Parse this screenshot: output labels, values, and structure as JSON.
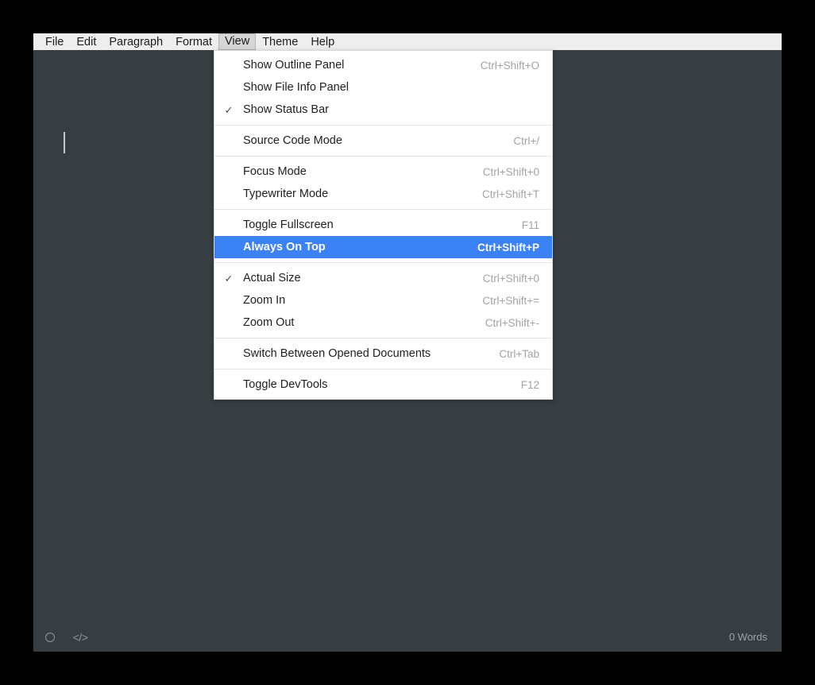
{
  "window": {
    "background_color": "#373e42",
    "menubar_color": "#eeeeee",
    "accent_color": "#3b82f6"
  },
  "menubar": {
    "items": [
      {
        "label": "File",
        "active": false
      },
      {
        "label": "Edit",
        "active": false
      },
      {
        "label": "Paragraph",
        "active": false
      },
      {
        "label": "Format",
        "active": false
      },
      {
        "label": "View",
        "active": true
      },
      {
        "label": "Theme",
        "active": false
      },
      {
        "label": "Help",
        "active": false
      }
    ]
  },
  "view_menu": {
    "groups": [
      {
        "items": [
          {
            "label": "Show Outline Panel",
            "shortcut": "Ctrl+Shift+O",
            "checked": false,
            "highlighted": false
          },
          {
            "label": "Show File Info Panel",
            "shortcut": "",
            "checked": false,
            "highlighted": false
          },
          {
            "label": "Show Status Bar",
            "shortcut": "",
            "checked": true,
            "highlighted": false
          }
        ]
      },
      {
        "items": [
          {
            "label": "Source Code Mode",
            "shortcut": "Ctrl+/",
            "checked": false,
            "highlighted": false
          }
        ]
      },
      {
        "items": [
          {
            "label": "Focus Mode",
            "shortcut": "Ctrl+Shift+0",
            "checked": false,
            "highlighted": false
          },
          {
            "label": "Typewriter Mode",
            "shortcut": "Ctrl+Shift+T",
            "checked": false,
            "highlighted": false
          }
        ]
      },
      {
        "items": [
          {
            "label": "Toggle Fullscreen",
            "shortcut": "F11",
            "checked": false,
            "highlighted": false
          },
          {
            "label": "Always On Top",
            "shortcut": "Ctrl+Shift+P",
            "checked": false,
            "highlighted": true
          }
        ]
      },
      {
        "items": [
          {
            "label": "Actual Size",
            "shortcut": "Ctrl+Shift+0",
            "checked": true,
            "highlighted": false
          },
          {
            "label": "Zoom In",
            "shortcut": "Ctrl+Shift+=",
            "checked": false,
            "highlighted": false
          },
          {
            "label": "Zoom Out",
            "shortcut": "Ctrl+Shift+-",
            "checked": false,
            "highlighted": false
          }
        ]
      },
      {
        "items": [
          {
            "label": "Switch Between Opened Documents",
            "shortcut": "Ctrl+Tab",
            "checked": false,
            "highlighted": false
          }
        ]
      },
      {
        "items": [
          {
            "label": "Toggle DevTools",
            "shortcut": "F12",
            "checked": false,
            "highlighted": false
          }
        ]
      }
    ],
    "check_glyph": "✓"
  },
  "editor": {
    "content": ""
  },
  "statusbar": {
    "icons": [
      {
        "name": "focus-circle-icon",
        "glyph": "circle"
      },
      {
        "name": "source-code-icon",
        "glyph": "</>"
      }
    ],
    "word_count": "0 Words"
  }
}
